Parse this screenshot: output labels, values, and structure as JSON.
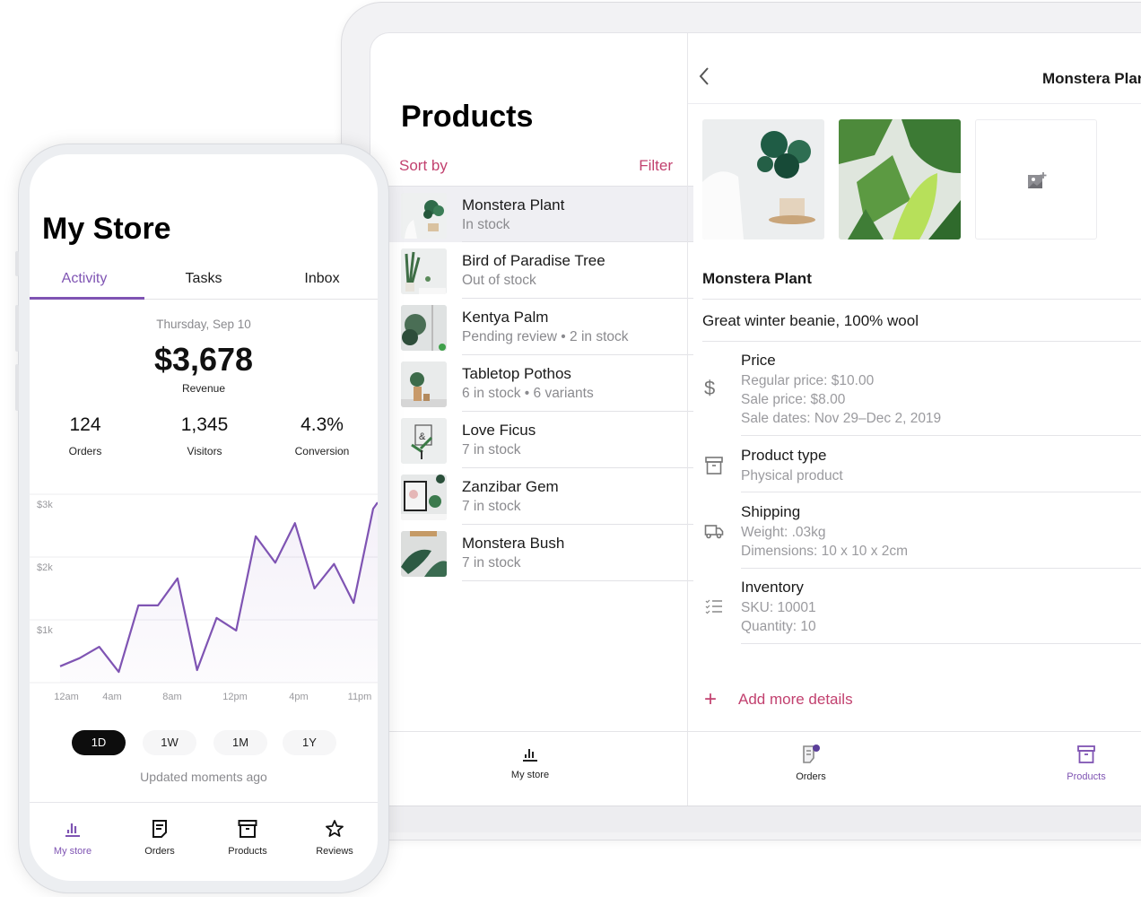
{
  "colors": {
    "accent": "#7f54b3",
    "link": "#c2416f",
    "muted": "#8a8a8e"
  },
  "phone": {
    "title": "My Store",
    "tabs": [
      {
        "label": "Activity",
        "active": true
      },
      {
        "label": "Tasks",
        "active": false
      },
      {
        "label": "Inbox",
        "active": false
      }
    ],
    "date": "Thursday, Sep 10",
    "revenue": {
      "value": "$3,678",
      "label": "Revenue"
    },
    "stats": [
      {
        "value": "124",
        "label": "Orders"
      },
      {
        "value": "1,345",
        "label": "Visitors"
      },
      {
        "value": "4.3%",
        "label": "Conversion"
      }
    ],
    "ranges": [
      {
        "label": "1D",
        "active": true
      },
      {
        "label": "1W",
        "active": false
      },
      {
        "label": "1M",
        "active": false
      },
      {
        "label": "1Y",
        "active": false
      }
    ],
    "updated": "Updated moments ago",
    "tabbar": [
      {
        "label": "My store",
        "icon": "bar-chart-icon",
        "active": true
      },
      {
        "label": "Orders",
        "icon": "document-icon",
        "active": false
      },
      {
        "label": "Products",
        "icon": "archive-box-icon",
        "active": false
      },
      {
        "label": "Reviews",
        "icon": "star-icon",
        "active": false
      }
    ]
  },
  "chart_data": {
    "type": "area",
    "title": "",
    "xlabel": "",
    "ylabel": "Revenue",
    "x_tick_labels": [
      "12am",
      "4am",
      "8am",
      "12pm",
      "4pm",
      "11pm"
    ],
    "y_tick_labels": [
      "$1k",
      "$2k",
      "$3k"
    ],
    "y_ticks": [
      1000,
      2000,
      3000
    ],
    "ylim": [
      0,
      3000
    ],
    "grid": true,
    "series": [
      {
        "name": "Revenue",
        "color": "#7f54b3",
        "values": [
          260,
          390,
          570,
          170,
          1230,
          1230,
          1660,
          200,
          1030,
          830,
          2330,
          1910,
          2540,
          1500,
          1890,
          1270,
          2770,
          2870
        ]
      }
    ]
  },
  "tablet": {
    "list": {
      "title": "Products",
      "sort_label": "Sort by",
      "filter_label": "Filter",
      "items": [
        {
          "name": "Monstera Plant",
          "status": "In stock",
          "selected": true
        },
        {
          "name": "Bird of Paradise Tree",
          "status": "Out of stock",
          "selected": false
        },
        {
          "name": "Kentya Palm",
          "status": "Pending review • 2 in stock",
          "selected": false
        },
        {
          "name": "Tabletop Pothos",
          "status": "6 in stock • 6 variants",
          "selected": false
        },
        {
          "name": "Love Ficus",
          "status": "7 in stock",
          "selected": false
        },
        {
          "name": "Zanzibar Gem",
          "status": "7 in stock",
          "selected": false
        },
        {
          "name": "Monstera Bush",
          "status": "7 in stock",
          "selected": false
        }
      ]
    },
    "detail": {
      "header_title": "Monstera Plant",
      "name": "Monstera Plant",
      "description": "Great winter beanie, 100% wool",
      "sections": [
        {
          "icon": "dollar-icon",
          "title": "Price",
          "lines": [
            "Regular price: $10.00",
            "Sale price: $8.00",
            "Sale dates: Nov 29–Dec 2, 2019"
          ]
        },
        {
          "icon": "archive-box-icon",
          "title": "Product type",
          "lines": [
            "Physical product"
          ]
        },
        {
          "icon": "truck-icon",
          "title": "Shipping",
          "lines": [
            "Weight: .03kg",
            "Dimensions: 10 x 10 x 2cm"
          ]
        },
        {
          "icon": "checklist-icon",
          "title": "Inventory",
          "lines": [
            "SKU: 10001",
            "Quantity: 10"
          ]
        }
      ],
      "add_more_label": "Add more details"
    },
    "tabbar": [
      {
        "label": "My store",
        "icon": "bar-chart-icon",
        "active": false
      },
      {
        "label": "Orders",
        "icon": "document-icon",
        "active": false,
        "badge": true
      },
      {
        "label": "Products",
        "icon": "archive-box-icon",
        "active": true
      }
    ]
  }
}
